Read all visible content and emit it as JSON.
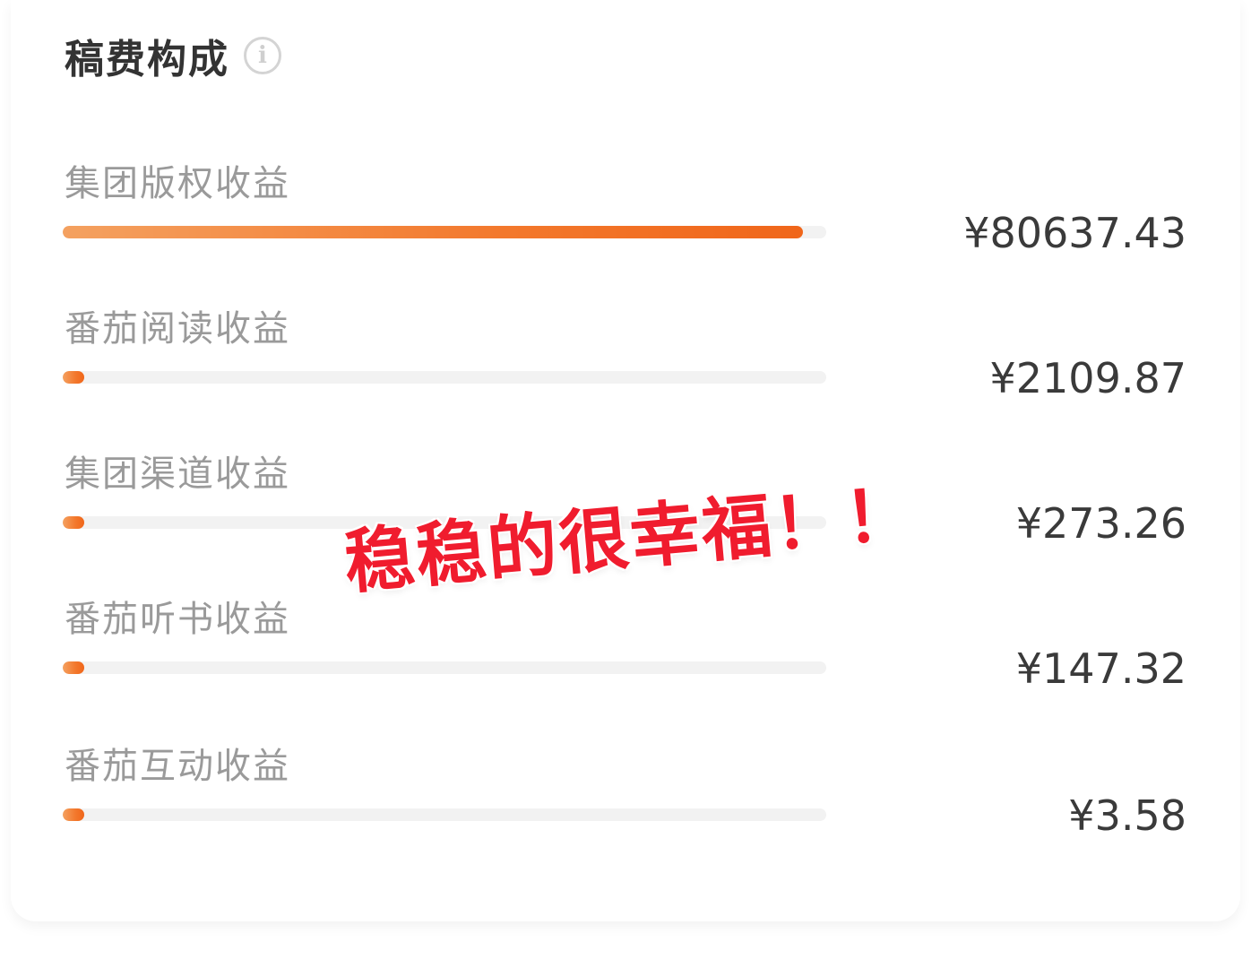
{
  "header": {
    "title": "稿费构成",
    "info_icon": "info-icon",
    "info_glyph": "i"
  },
  "rows": [
    {
      "label": "集团版权收益",
      "amount": "¥80637.43",
      "share": 0.969
    },
    {
      "label": "番茄阅读收益",
      "amount": "¥2109.87",
      "share": 0.025
    },
    {
      "label": "集团渠道收益",
      "amount": "¥273.26",
      "share": 0.0033
    },
    {
      "label": "番茄听书收益",
      "amount": "¥147.32",
      "share": 0.0018
    },
    {
      "label": "番茄互动收益",
      "amount": "¥3.58",
      "share": 4e-05
    }
  ],
  "overlay": {
    "text": "稳稳的很幸福！！"
  },
  "colors": {
    "accent": "#f3782c",
    "track": "#f2f2f2",
    "overlay_red": "#f01c2e"
  }
}
